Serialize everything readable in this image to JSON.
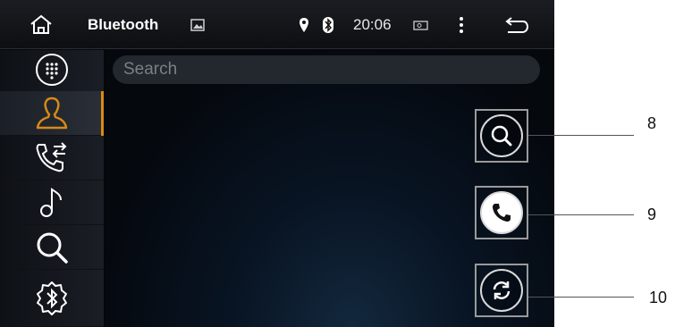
{
  "statusbar": {
    "title": "Bluetooth",
    "time": "20:06"
  },
  "search": {
    "placeholder": "Search"
  },
  "sidebar": {
    "items": [
      "dialpad",
      "contacts",
      "call-log",
      "music",
      "search",
      "bluetooth-settings"
    ]
  },
  "callouts": [
    "8",
    "9",
    "10"
  ],
  "colors": {
    "accent": "#d98a16",
    "background": "#05070c"
  }
}
